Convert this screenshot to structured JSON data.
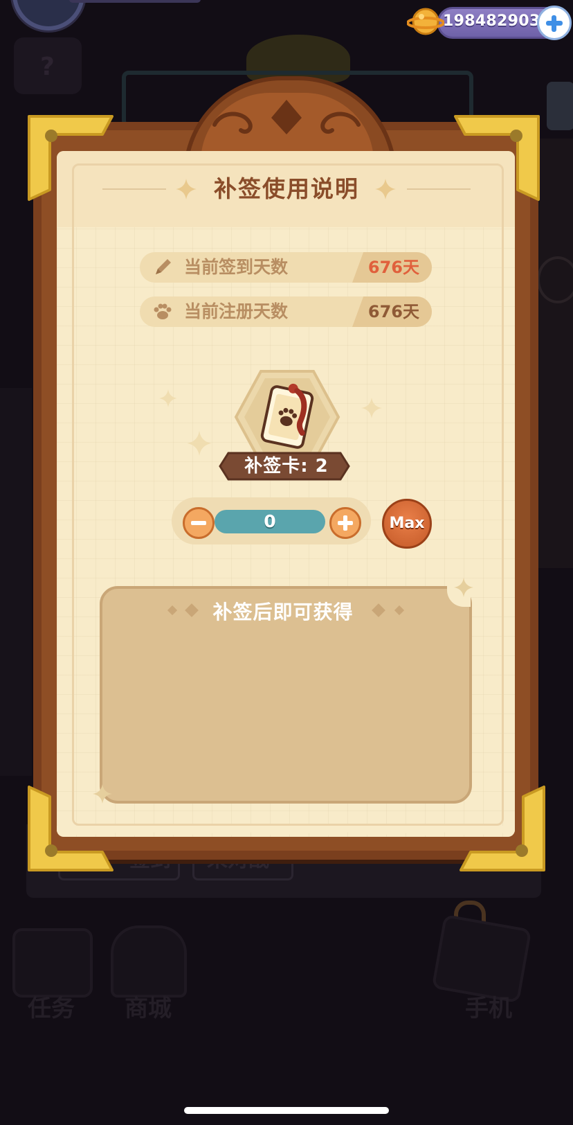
{
  "currency": {
    "amount": "198482903",
    "coin_icon": "coin-planet-icon",
    "add_icon": "plus-icon"
  },
  "dialog": {
    "title": "补签使用说明",
    "stats": [
      {
        "label": "当前签到天数",
        "value": "676天",
        "icon": "pencil-icon",
        "value_color": "#e0603c"
      },
      {
        "label": "当前注册天数",
        "value": "676天",
        "icon": "paw-icon",
        "value_color": "#8f5a36"
      }
    ],
    "card": {
      "label": "补签卡: 2",
      "icon": "paw-tag-card-icon"
    },
    "stepper": {
      "value": "0",
      "minus_icon": "minus-icon",
      "plus_icon": "plus-icon",
      "max_label": "Max"
    },
    "reward_panel": {
      "title": "补签后即可获得"
    }
  },
  "background": {
    "nav_items": [
      "任务",
      "商城",
      "手机"
    ],
    "buttons": [
      "签到",
      "来对战"
    ]
  },
  "colors": {
    "frame": "#8a4a22",
    "paper": "#f8ebc9",
    "gold_corner": "#f0c94a",
    "accent_orange": "#e0603c",
    "input_teal": "#5aa5ad"
  }
}
